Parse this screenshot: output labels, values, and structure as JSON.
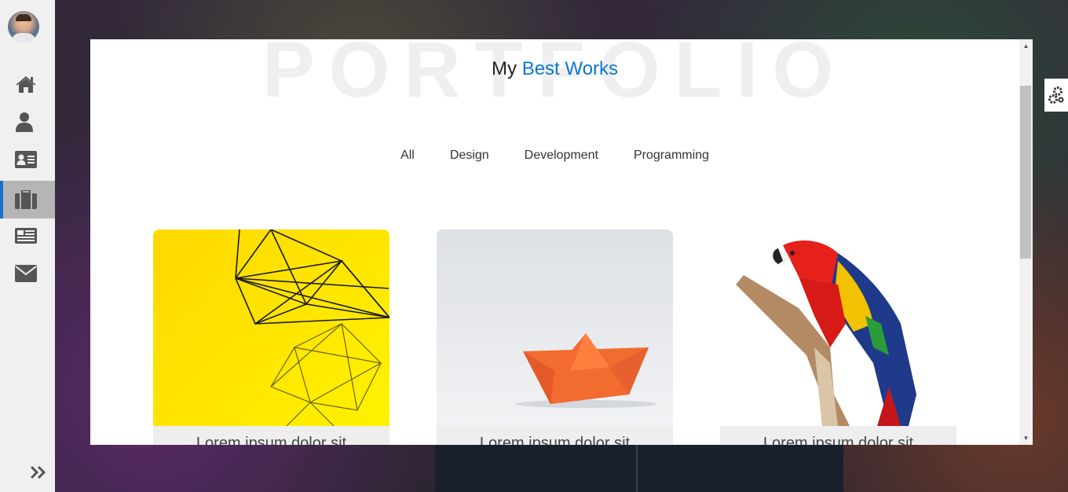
{
  "nav": {
    "items": [
      {
        "name": "home-icon"
      },
      {
        "name": "user-icon"
      },
      {
        "name": "id-card-icon"
      },
      {
        "name": "briefcase-icon",
        "active": true
      },
      {
        "name": "newspaper-icon"
      },
      {
        "name": "envelope-icon"
      }
    ],
    "expand_icon": "double-chevron-right-icon"
  },
  "portfolio": {
    "watermark": "PORTFOLIO",
    "title_prefix": "My",
    "title_accent": "Best Works",
    "accent_color": "#0b78d0",
    "filters": [
      "All",
      "Design",
      "Development",
      "Programming"
    ],
    "cards": [
      {
        "caption": "Lorem ipsum dolor sit",
        "image": "yellow-geometric-wire"
      },
      {
        "caption": "Lorem ipsum dolor sit",
        "image": "orange-paper-boat"
      },
      {
        "caption": "Lorem ipsum dolor sit",
        "image": "red-macaw-parrot"
      }
    ]
  },
  "settings_icon": "gears-icon"
}
